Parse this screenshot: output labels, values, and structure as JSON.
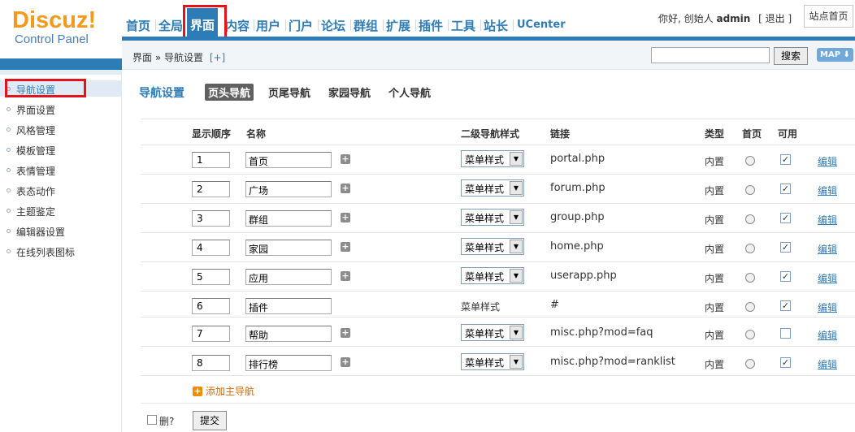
{
  "logo": {
    "main": "Discuz!",
    "sub": "Control Panel"
  },
  "topnav": [
    "首页",
    "全局",
    "界面",
    "内容",
    "用户",
    "门户",
    "论坛",
    "群组",
    "扩展",
    "插件",
    "工具",
    "站长",
    "UCenter"
  ],
  "user": {
    "greeting": "你好, 创始人",
    "name": "admin",
    "logout": "[ 退出 ]",
    "site_home": "站点首页"
  },
  "breadcrumb": {
    "text": "界面 » 导航设置",
    "plus": "[+]"
  },
  "search": {
    "button": "搜索",
    "map": "MAP ⬇"
  },
  "sidebar": [
    "导航设置",
    "界面设置",
    "风格管理",
    "模板管理",
    "表情管理",
    "表态动作",
    "主题鉴定",
    "编辑器设置",
    "在线列表图标"
  ],
  "content": {
    "title": "导航设置",
    "tabs": [
      "页头导航",
      "页尾导航",
      "家园导航",
      "个人导航"
    ],
    "headers": {
      "order": "显示顺序",
      "name": "名称",
      "style": "二级导航样式",
      "link": "链接",
      "type": "类型",
      "home": "首页",
      "enabled": "可用"
    },
    "rows": [
      {
        "order": "1",
        "name": "首页",
        "style": "菜单样式",
        "link": "portal.php",
        "type": "内置",
        "enabled": true,
        "edit": "编辑",
        "has_select": true
      },
      {
        "order": "2",
        "name": "广场",
        "style": "菜单样式",
        "link": "forum.php",
        "type": "内置",
        "enabled": true,
        "edit": "编辑",
        "has_select": true
      },
      {
        "order": "3",
        "name": "群组",
        "style": "菜单样式",
        "link": "group.php",
        "type": "内置",
        "enabled": true,
        "edit": "编辑",
        "has_select": true
      },
      {
        "order": "4",
        "name": "家园",
        "style": "菜单样式",
        "link": "home.php",
        "type": "内置",
        "enabled": true,
        "edit": "编辑",
        "has_select": true
      },
      {
        "order": "5",
        "name": "应用",
        "style": "菜单样式",
        "link": "userapp.php",
        "type": "内置",
        "enabled": true,
        "edit": "编辑",
        "has_select": true
      },
      {
        "order": "6",
        "name": "插件",
        "style": "菜单样式",
        "link": "#",
        "type": "内置",
        "enabled": true,
        "edit": "编辑",
        "has_select": false
      },
      {
        "order": "7",
        "name": "帮助",
        "style": "菜单样式",
        "link": "misc.php?mod=faq",
        "type": "内置",
        "enabled": false,
        "edit": "编辑",
        "has_select": true
      },
      {
        "order": "8",
        "name": "排行榜",
        "style": "菜单样式",
        "link": "misc.php?mod=ranklist",
        "type": "内置",
        "enabled": true,
        "edit": "编辑",
        "has_select": true
      }
    ],
    "add_main": "添加主导航",
    "delete_label": "删?",
    "submit": "提交"
  }
}
